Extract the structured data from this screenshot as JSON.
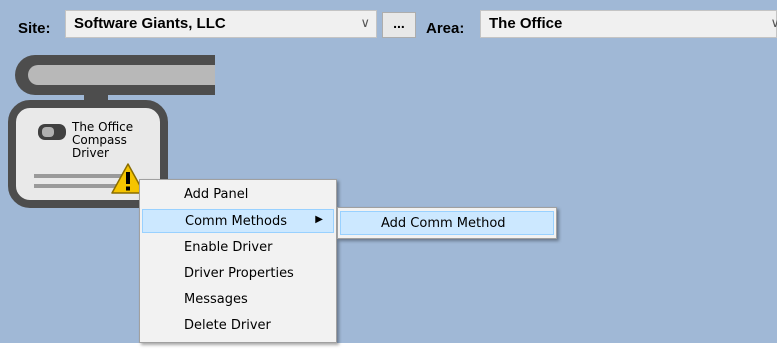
{
  "toolbar": {
    "site_label": "Site:",
    "site_value": "Software Giants, LLC",
    "browse_label": "...",
    "area_label": "Area:",
    "area_value": "The Office"
  },
  "driver": {
    "line1": "The Office",
    "line2": "Compass",
    "line3": "Driver"
  },
  "context_menu": {
    "items": [
      {
        "label": "Add Panel"
      },
      {
        "label": "Comm Methods",
        "highlighted": true,
        "has_submenu": true
      },
      {
        "label": "Enable Driver"
      },
      {
        "label": "Driver Properties"
      },
      {
        "label": "Messages"
      },
      {
        "label": "Delete Driver"
      }
    ]
  },
  "submenu": {
    "items": [
      {
        "label": "Add Comm Method",
        "highlighted": true
      }
    ]
  },
  "colors": {
    "canvas": "#a0b8d6",
    "menu_highlight": "#cce8ff",
    "menu_highlight_border": "#99d1ff",
    "warning": "#f5c400"
  },
  "icons": {
    "dropdown": "chevron-down-icon",
    "submenu_arrow": "triangle-right-icon",
    "warning": "warning-icon",
    "driver_status": "toggle-icon"
  }
}
